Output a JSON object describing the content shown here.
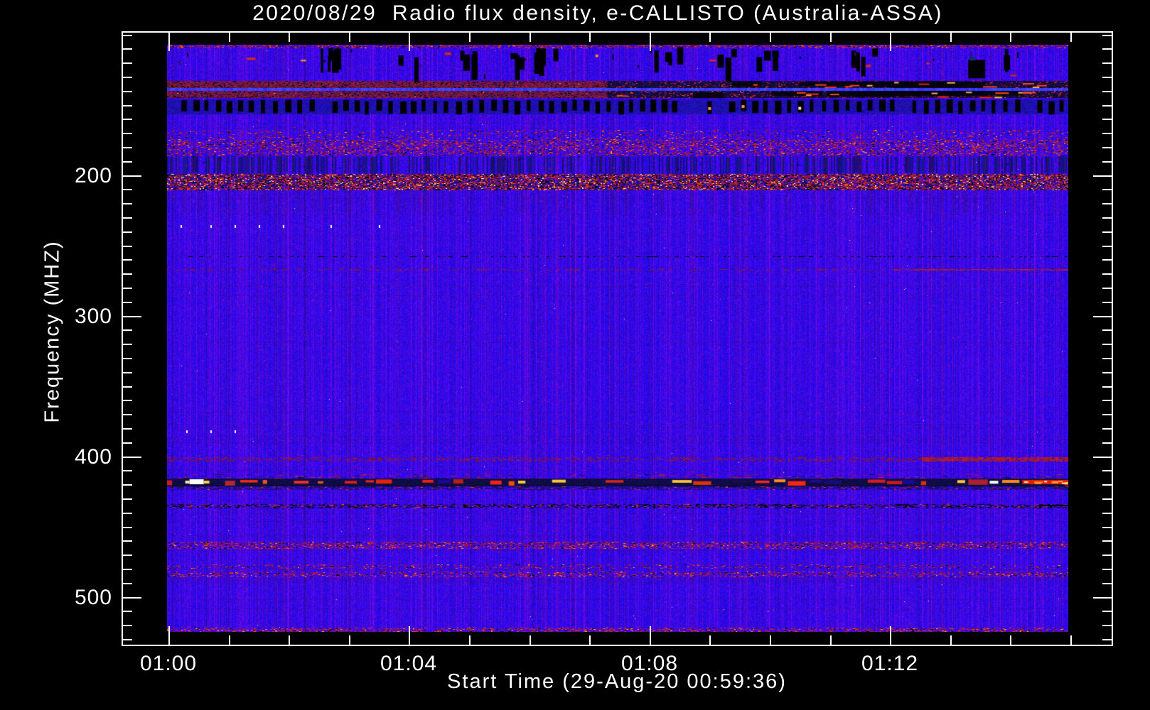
{
  "chart_data": {
    "type": "heatmap",
    "title": "2020/08/29  Radio flux density, e-CALLISTO (Australia-ASSA)",
    "instrument": "e-CALLISTO (Australia-ASSA)",
    "date": "2020/08/29",
    "x_axis": {
      "label": "Start Time (29-Aug-20 00:59:36)",
      "major_ticks": [
        {
          "label": "01:00",
          "minute": 60
        },
        {
          "label": "01:04",
          "minute": 64
        },
        {
          "label": "01:08",
          "minute": 68
        },
        {
          "label": "01:12",
          "minute": 72
        }
      ],
      "minor_tick_step_minutes": 1,
      "minor_tick_range_minutes": [
        61,
        75
      ],
      "axis_range_minutes": [
        59.2,
        75.7
      ],
      "data_range_minutes": [
        59.98,
        74.97
      ]
    },
    "y_axis": {
      "label": "Frequency (MHZ)",
      "major_ticks": [
        200,
        300,
        400,
        500
      ],
      "minor_tick_step_mhz": 10,
      "minor_tick_range_mhz": [
        100,
        530
      ],
      "axis_range_mhz": [
        98,
        534
      ],
      "data_range_mhz": [
        107.5,
        525
      ],
      "inverted": true
    },
    "legend": "none",
    "grid": "off",
    "palette": {
      "background": "#000000",
      "frame": "#ffffff",
      "text": "#ffffff",
      "base_blue": "#2012eb",
      "noise_purple": "#6a1ab0",
      "speckle_dark_red": "#8c1e30",
      "bright_red": "#ee2400",
      "orange": "#ff8c1e",
      "yellow": "#ffd24a",
      "white_burst": "#ffffff",
      "dropout_black": "#000000"
    },
    "features_note": "Quiet solar radio background (uniform blue) crossed by horizontal RFI bands and black dropout blocks; strongest interference band near 416-421 MHz with red/white/yellow bursts.",
    "bands": [
      {
        "name": "top-edge-noise",
        "f": [
          107.5,
          110
        ],
        "style": "speckle",
        "density": 0.3
      },
      {
        "name": "vhf-band-133-138",
        "f": [
          133,
          138
        ],
        "style": "mottled_red",
        "right_dark_from_minute": 67.3
      },
      {
        "name": "bright-gap-line",
        "f": [
          138,
          140
        ],
        "style": "bright_blue"
      },
      {
        "name": "vhf-band-140-145",
        "f": [
          140,
          145
        ],
        "style": "mottled_red",
        "right_dark_from_minute": 67.3
      },
      {
        "name": "barcode-dropouts-146-157",
        "f": [
          146,
          157
        ],
        "style": "barcode"
      },
      {
        "name": "speckle-168-175",
        "f": [
          168,
          175
        ],
        "style": "speckle",
        "density": 0.1
      },
      {
        "name": "speckle-175-186",
        "f": [
          175,
          186
        ],
        "style": "speckle",
        "density": 0.26
      },
      {
        "name": "striped-186-199",
        "f": [
          186,
          199
        ],
        "style": "stripes"
      },
      {
        "name": "speckle-strong-199-211",
        "f": [
          199,
          211
        ],
        "style": "speckle_strong"
      },
      {
        "name": "smudge-211-227",
        "f": [
          211,
          227
        ],
        "style": "stripes_soft"
      },
      {
        "name": "white-dot-row-236",
        "f": [
          236,
          236.6
        ],
        "style": "dot_row",
        "dots_minute": [
          60.2,
          60.7,
          61.1,
          61.5,
          61.9,
          62.7,
          63.5
        ]
      },
      {
        "name": "dark-dash-row-258",
        "f": [
          258,
          258.6
        ],
        "style": "dash_row"
      },
      {
        "name": "red-speckle-row-267",
        "f": [
          267,
          267.8
        ],
        "style": "faint_red_line",
        "right_boost_minute": 72
      },
      {
        "name": "white-dot-row-382",
        "f": [
          382,
          382.6
        ],
        "style": "dot_row",
        "dots_minute": [
          60.3,
          60.7,
          61.1
        ]
      },
      {
        "name": "faint-red-line-402",
        "f": [
          401,
          404
        ],
        "style": "faint_red_line",
        "right_boost_minute": 72.5
      },
      {
        "name": "main-rfi-band-416-421",
        "f": [
          413,
          424
        ],
        "core_f": [
          416,
          421
        ],
        "style": "main_band",
        "white_blob_minute": 60.35,
        "right_solid_from_minute": 74.2
      },
      {
        "name": "dark-line-434-437",
        "f": [
          434,
          437
        ],
        "style": "dark_speckle_line",
        "solid_right_from_minute": 74.5
      },
      {
        "name": "speckle-461-466",
        "f": [
          461,
          466
        ],
        "style": "speckle",
        "density": 0.3
      },
      {
        "name": "speckle-477-480",
        "f": [
          477,
          480
        ],
        "style": "speckle",
        "density": 0.12
      },
      {
        "name": "speckle-482-486",
        "f": [
          482,
          486
        ],
        "style": "speckle",
        "density": 0.24
      },
      {
        "name": "bottom-edge-noise",
        "f": [
          522,
          525
        ],
        "style": "speckle",
        "density": 0.3
      }
    ],
    "dropout_zone": {
      "f": [
        109,
        132
      ],
      "cluster_minutes": [
        62.7,
        63.9,
        64.9,
        65.9,
        66.3,
        68.2,
        69.1,
        69.8,
        71.5,
        73.7
      ],
      "big_block_minute": 73.3,
      "red_dot_minutes": [
        61.3,
        62.2,
        64.6,
        67.1,
        69.0,
        71.6,
        72.6,
        74.0
      ]
    }
  }
}
